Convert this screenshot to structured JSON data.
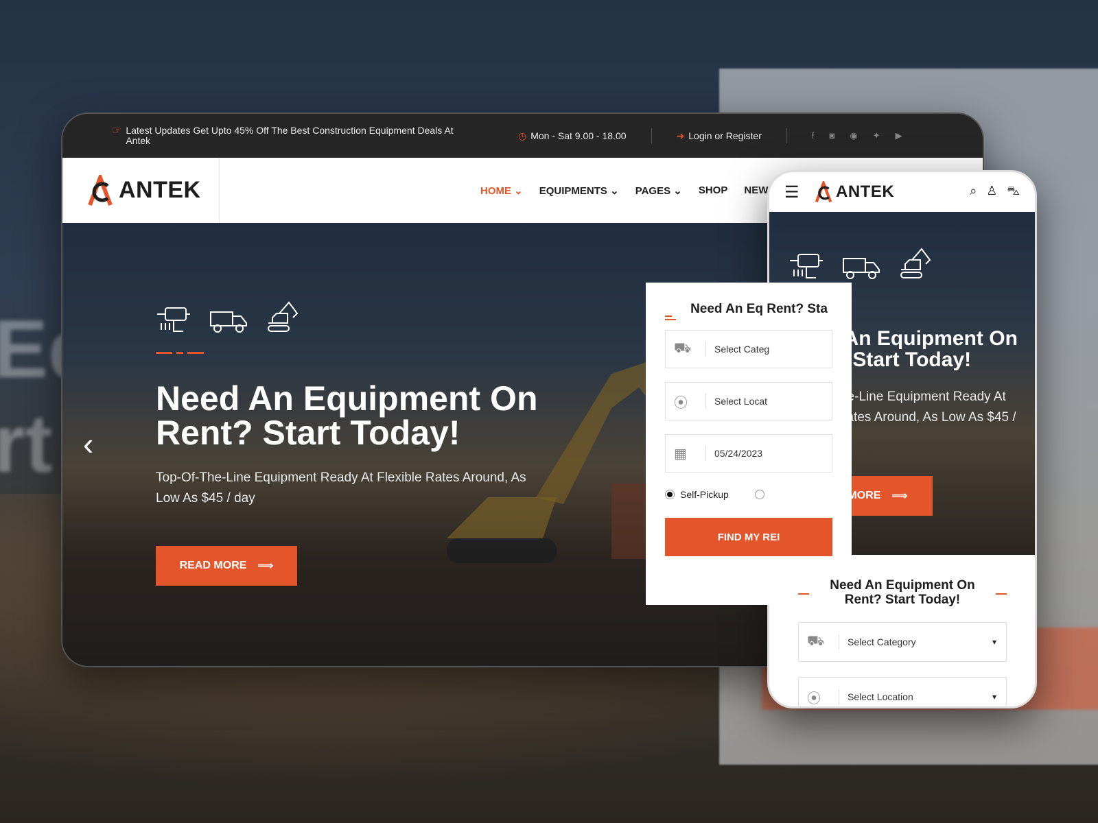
{
  "topbar": {
    "promo": "Latest Updates Get Upto 45% Off The Best Construction Equipment Deals At Antek",
    "hours": "Mon - Sat 9.00 - 18.00",
    "login": "Login or Register",
    "socials": [
      "facebook-icon",
      "instagram-icon",
      "whatsapp-icon",
      "twitter-icon",
      "youtube-icon"
    ]
  },
  "brand": {
    "name": "ANTEK",
    "accent": "#e4552b"
  },
  "nav": {
    "items": [
      {
        "label": "HOME",
        "caret": "⌄"
      },
      {
        "label": "EQUIPMENTS",
        "caret": "⌄"
      },
      {
        "label": "PAGES",
        "caret": "⌄"
      },
      {
        "label": "SHOP",
        "caret": ""
      },
      {
        "label": "NEWS",
        "caret": ""
      }
    ]
  },
  "hero": {
    "title": "Need An Equipment On Rent? Start Today!",
    "subtitle": "Top-Of-The-Line Equipment Ready At Flexible Rates Around, As Low As $45 / day",
    "button": "READ MORE"
  },
  "form": {
    "title_visible": "Need An Eq Rent? Sta",
    "category_placeholder": "Select Categ",
    "location_placeholder": "Select Locat",
    "date_value": "05/24/2023",
    "radio_label": "Self-Pickup",
    "submit": "FIND MY REI"
  },
  "mobile": {
    "brand": "ANTEK",
    "hero_title": "Need An Equipment On Rent? Start Today!",
    "hero_subtitle": "Top-Of-The-Line Equipment Ready At Flexible Rates Around, As Low As $45 / day",
    "button": "READ MORE",
    "form_title": "Need An Equipment On Rent? Start Today!",
    "category": "Select Category",
    "location": "Select Location"
  }
}
